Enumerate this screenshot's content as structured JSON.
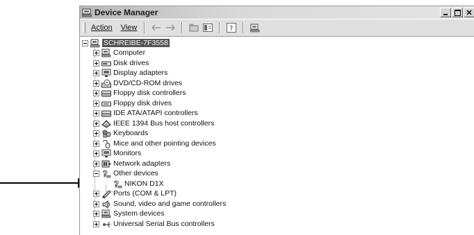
{
  "window": {
    "title": "Device Manager"
  },
  "menu": [
    {
      "label": "Action"
    },
    {
      "label": "View"
    }
  ],
  "tree": {
    "root": "SCHREIBE-7F3558",
    "categories": [
      {
        "label": "Computer",
        "icon": "computer-icon"
      },
      {
        "label": "Disk drives",
        "icon": "disk-drive-icon"
      },
      {
        "label": "Display adapters",
        "icon": "monitor-icon"
      },
      {
        "label": "DVD/CD-ROM drives",
        "icon": "cdrom-icon"
      },
      {
        "label": "Floppy disk controllers",
        "icon": "controller-icon"
      },
      {
        "label": "Floppy disk drives",
        "icon": "floppy-drive-icon"
      },
      {
        "label": "IDE ATA/ATAPI controllers",
        "icon": "controller-icon"
      },
      {
        "label": "IEEE 1394 Bus host controllers",
        "icon": "ieee1394-icon"
      },
      {
        "label": "Keyboards",
        "icon": "keyboard-icon"
      },
      {
        "label": "Mice and other pointing devices",
        "icon": "mouse-icon"
      },
      {
        "label": "Monitors",
        "icon": "monitor-icon"
      },
      {
        "label": "Network adapters",
        "icon": "network-adapter-icon"
      },
      {
        "label": "Other devices",
        "icon": "unknown-device-icon",
        "expanded": true,
        "children": [
          {
            "label": "NIKON D1X",
            "icon": "unknown-device-icon"
          }
        ]
      },
      {
        "label": "Ports (COM & LPT)",
        "icon": "port-icon"
      },
      {
        "label": "Sound, video and game controllers",
        "icon": "sound-icon"
      },
      {
        "label": "System devices",
        "icon": "computer-icon"
      },
      {
        "label": "Universal Serial Bus controllers",
        "icon": "usb-icon"
      }
    ]
  }
}
